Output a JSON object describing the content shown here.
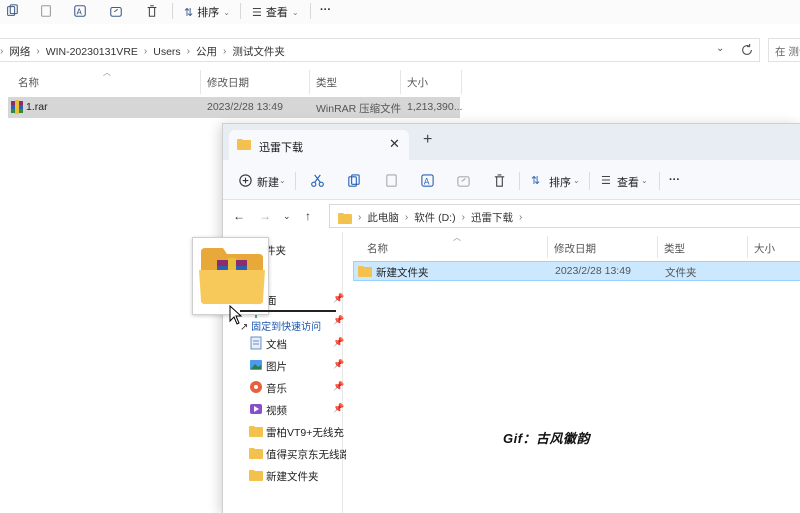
{
  "background_window": {
    "toolbar": {
      "sort_label": "排序",
      "view_label": "查看",
      "more_label": "···"
    },
    "breadcrumb": [
      "网络",
      "WIN-20230131VRE",
      "Users",
      "公用",
      "测试文件夹"
    ],
    "search_placeholder": "在 测试",
    "columns": {
      "name": "名称",
      "modified": "修改日期",
      "type": "类型",
      "size": "大小"
    },
    "file": {
      "name": "1.rar",
      "modified": "2023/2/28 13:49",
      "type": "WinRAR 压缩文件",
      "size": "1,213,390..."
    }
  },
  "foreground_window": {
    "tab_title": "迅雷下载",
    "close_glyph": "✕",
    "new_tab_glyph": "+",
    "commands": {
      "new_label": "新建",
      "sort_label": "排序",
      "view_label": "查看",
      "more_label": "···"
    },
    "breadcrumb": [
      "此电脑",
      "软件 (D:)",
      "迅雷下载"
    ],
    "sidebar": {
      "header": "件夹",
      "items": [
        {
          "label": "面",
          "icon": "desktop-icon",
          "pinned": true
        },
        {
          "label": "",
          "icon": "download-icon",
          "pinned": true
        },
        {
          "label": "文档",
          "icon": "documents-icon",
          "pinned": true
        },
        {
          "label": "图片",
          "icon": "pictures-icon",
          "pinned": true
        },
        {
          "label": "音乐",
          "icon": "music-icon",
          "pinned": true
        },
        {
          "label": "视频",
          "icon": "videos-icon",
          "pinned": true
        },
        {
          "label": "雷柏VT9+无线充",
          "icon": "folder-icon",
          "pinned": false
        },
        {
          "label": "值得买京东无线路由",
          "icon": "folder-icon",
          "pinned": false
        },
        {
          "label": "新建文件夹",
          "icon": "folder-icon",
          "pinned": false
        }
      ]
    },
    "columns": {
      "name": "名称",
      "modified": "修改日期",
      "type": "类型",
      "size": "大小"
    },
    "row": {
      "name": "新建文件夹",
      "modified": "2023/2/28 13:49",
      "type": "文件夹"
    }
  },
  "drag": {
    "tooltip": "固定到快速访问"
  },
  "watermark": "Gif：古风徽韵",
  "colors": {
    "selection": "#cce8ff",
    "accent": "#2a63b8",
    "folder": "#f2c14e"
  }
}
